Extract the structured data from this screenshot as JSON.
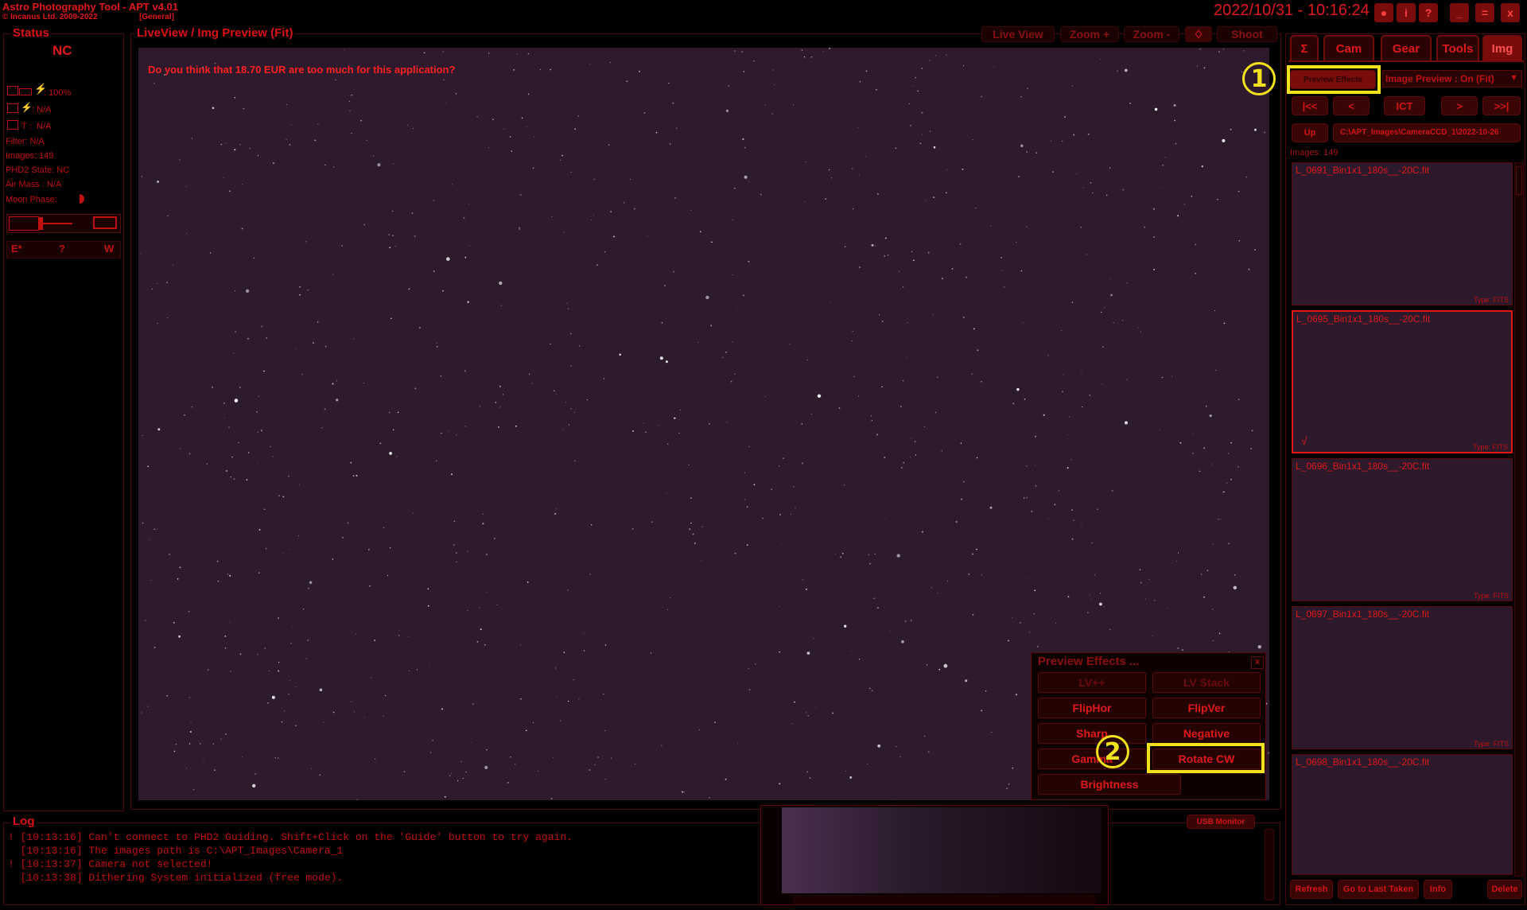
{
  "titlebar": {
    "app_title": "Astro Photography Tool  -  APT v4.01",
    "company": "© Incanus Ltd. 2009-2022",
    "profile": "[General]",
    "datetime": "2022/10/31 - 10:16:24",
    "buttons": [
      "●",
      "i",
      "?",
      "_",
      "=",
      "x"
    ]
  },
  "status": {
    "title": "Status",
    "connection": "NC",
    "battery": ": 100%",
    "power": ": N/A",
    "temp_label": "T :",
    "temp": "N/A",
    "filter": "Filter: N/A",
    "images": "Images: 149",
    "phd2": "PHD2 State: NC",
    "airmass": "Air Mass : N/A",
    "moon": "Moon Phase:",
    "buttons": [
      "E*",
      "?",
      "W"
    ]
  },
  "preview": {
    "title": "LiveView / Img Preview (Fit)",
    "toolbar": [
      "Live View",
      "Zoom +",
      "Zoom -",
      "♢",
      "Shoot"
    ],
    "nag_text": "Do you think that 18.70 EUR are too much for this application?"
  },
  "preview_effects": {
    "title": "Preview Effects ...",
    "close": "x",
    "buttons": [
      "LV++",
      "LV Stack",
      "FlipHor",
      "FlipVer",
      "Sharp",
      "Negative",
      "Gamma",
      "Rotate CW",
      "Brightness"
    ]
  },
  "right_panel": {
    "tabs": [
      "Σ",
      "Cam",
      "Gear",
      "Tools",
      "Img"
    ],
    "preview_effects_btn": "Preview Effects",
    "image_preview_select": "Image Preview : On (Fit)",
    "nav": [
      "|<<",
      "<",
      "ICT",
      ">",
      ">>|"
    ],
    "up": "Up",
    "path": "C:\\APT_Images\\CameraCCD_1\\2022-10-26",
    "images_count": "Images: 149",
    "thumbnails": [
      {
        "name": "L_0691_Bin1x1_180s__-20C.fit",
        "type": "Type: FITS"
      },
      {
        "name": "L_0695_Bin1x1_180s__-20C.fit",
        "type": "Type: FITS"
      },
      {
        "name": "L_0696_Bin1x1_180s__-20C.fit",
        "type": "Type: FITS"
      },
      {
        "name": "L_0697_Bin1x1_180s__-20C.fit",
        "type": "Type: FITS"
      },
      {
        "name": "L_0698_Bin1x1_180s__-20C.fit",
        "type": "Type: FITS"
      }
    ],
    "bottom_buttons": [
      "Refresh",
      "Go to Last Taken",
      "Info",
      "Delete"
    ]
  },
  "log": {
    "title": "Log",
    "usb_monitor": "USB Monitor",
    "lines": [
      "! [10:13:16] Can't connect to PHD2 Guiding. Shift+Click on the 'Guide' button to try again.",
      "  [10:13:16] The images path is C:\\APT_Images\\Camera_1",
      "! [10:13:37] Camera not selected!",
      "  [10:13:38] Dithering System initialized (free mode)."
    ]
  },
  "annotations": {
    "marker1": "1",
    "marker2": "2"
  },
  "colors": {
    "accent": "#e01818",
    "background": "#000000",
    "sky": "#2d1a2d",
    "highlight": "#f2e11c"
  }
}
